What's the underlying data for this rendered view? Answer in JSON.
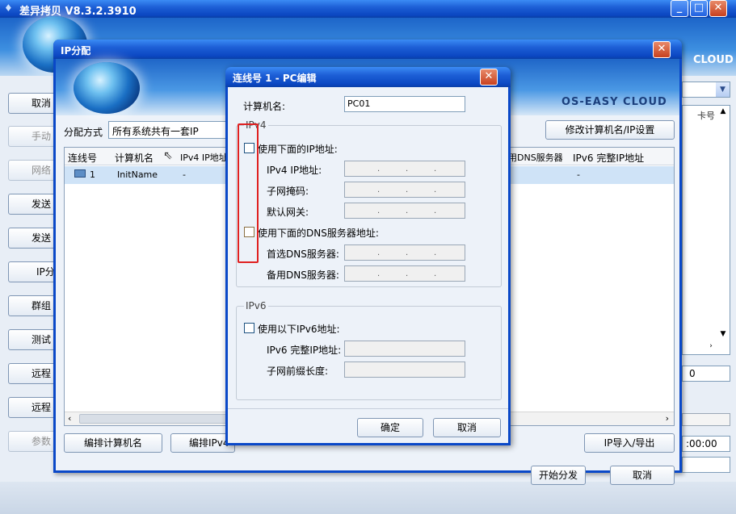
{
  "main_window": {
    "title": "差异拷贝 V8.3.2.3910",
    "logo_text": "CLOUD",
    "left_buttons": [
      "取消",
      "手动",
      "网络",
      "发送",
      "发送",
      "IP分",
      "群组",
      "测试",
      "远程",
      "远程",
      "参数"
    ],
    "right_field": "0",
    "right_time": ":00:00",
    "header_fragment": "卡号"
  },
  "ip_dialog": {
    "title": "IP分配",
    "logo_text": "OS-EASY CLOUD",
    "assign_label": "分配方式",
    "assign_value": "所有系统共有一套IP",
    "modify_button": "修改计算机名/IP设置",
    "columns": [
      "连线号",
      "计算机名",
      "IPv4 IP地址"
    ],
    "right_columns": [
      "用DNS服务器",
      "IPv6 完整IP地址"
    ],
    "row": {
      "id": "1",
      "name": "InitName",
      "ipv4": "-",
      "ipv6": "-"
    },
    "btn_edit_name": "编排计算机名",
    "btn_edit_ipv4": "编排IPv4",
    "btn_import": "IP导入/导出",
    "btn_start": "开始分发",
    "btn_cancel": "取消"
  },
  "pc_dialog": {
    "title": "连线号 1 - PC编辑",
    "name_label": "计算机名:",
    "name_value": "PC01",
    "ipv4_group": "IPv4",
    "use_ip_label": "使用下面的IP地址:",
    "ipv4_label": "IPv4 IP地址:",
    "mask_label": "子网掩码:",
    "gateway_label": "默认网关:",
    "use_dns_label": "使用下面的DNS服务器地址:",
    "dns1_label": "首选DNS服务器:",
    "dns2_label": "备用DNS服务器:",
    "ipv6_group": "IPv6",
    "use_ipv6_label": "使用以下IPv6地址:",
    "ipv6_full_label": "IPv6 完整IP地址:",
    "prefix_label": "子网前缀长度:",
    "ok": "确定",
    "cancel": "取消"
  },
  "colors": {
    "titlebar": "#0b47c2",
    "highlight": "#e02020"
  }
}
